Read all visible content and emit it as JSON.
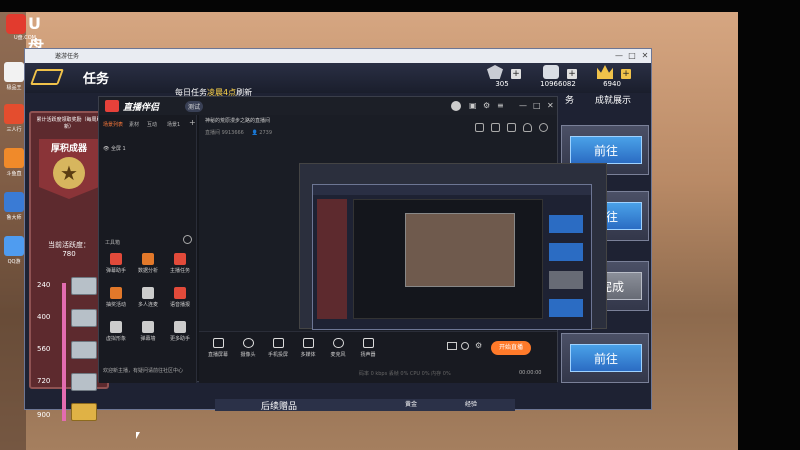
{
  "desktop": {
    "logo_text": "U盘",
    "logo_sub": "U盘.COM",
    "icons": [
      {
        "label": "极品王",
        "color": "#f2f2f2"
      },
      {
        "label": "三人行",
        "color": "#e44d2e"
      },
      {
        "label": "斗鱼直",
        "color": "#f08a2a"
      },
      {
        "label": "鲁大师",
        "color": "#3a7bd5"
      },
      {
        "label": "QQ游",
        "color": "#4f9cf0"
      }
    ]
  },
  "outer_window": {
    "title": "遨游任务",
    "controls": [
      "—",
      "□",
      "✕"
    ]
  },
  "game": {
    "title": "任务",
    "daily_prefix": "每日任务",
    "daily_highlight": "凌晨4点",
    "daily_suffix": "刷新",
    "tab_partial": "务",
    "tab_achievement": "成就展示",
    "resources": [
      {
        "icon": "rank-badge-icon",
        "value": "305"
      },
      {
        "icon": "cash-icon",
        "value": "10966082"
      },
      {
        "icon": "gold-crown-icon",
        "value": "6940"
      }
    ],
    "activity": {
      "top_text": "累计活跃度领取奖励（每周刷新）",
      "name": "厚积成器",
      "progress_label": "当前活跃度：",
      "progress_value": "780",
      "milestones": [
        "240",
        "400",
        "560",
        "720",
        "900"
      ]
    },
    "buttons": [
      {
        "label": "前往",
        "done": false
      },
      {
        "label": "前往",
        "done": false
      },
      {
        "label": "未完成",
        "done": true
      },
      {
        "label": "前往",
        "done": false
      }
    ],
    "bottom_labels": [
      "后续赠品",
      "黄金",
      "经验"
    ]
  },
  "stream_app": {
    "brand": "直播伴侣",
    "version": "测试",
    "side_tabs": [
      "场景列表",
      "素材",
      "互动",
      "场景1"
    ],
    "scene_label": "全屏 1",
    "tools_title": "工具箱",
    "tools": [
      {
        "label": "弹幕助手",
        "color": "#e24a3a"
      },
      {
        "label": "数据分析",
        "color": "#e2782a"
      },
      {
        "label": "主播任务",
        "color": "#e24a3a"
      },
      {
        "label": "抽奖活动",
        "color": "#e2782a"
      },
      {
        "label": "多人连麦",
        "color": "#cccccc"
      },
      {
        "label": "语音播报",
        "color": "#e24a3a"
      },
      {
        "label": "虚拟形象",
        "color": "#cccccc"
      },
      {
        "label": "弹幕墙",
        "color": "#cccccc"
      },
      {
        "label": "更多助手",
        "color": "#cccccc"
      }
    ],
    "notice": "欢迎新主播，有疑问请前往社区中心",
    "room_info": "神秘的荒原漫步之路的直播间",
    "room_sub": "直播间 9913666",
    "room_count": "2739",
    "bottom_tools": [
      "直播屏幕",
      "摄像头",
      "手机投屏",
      "多媒体",
      "麦克风",
      "扬声器"
    ],
    "live_label": "开始直播",
    "stats": "码率 0 kbps   丢帧 0%   CPU 0%   内存 0%",
    "timer": "00:00:00"
  }
}
